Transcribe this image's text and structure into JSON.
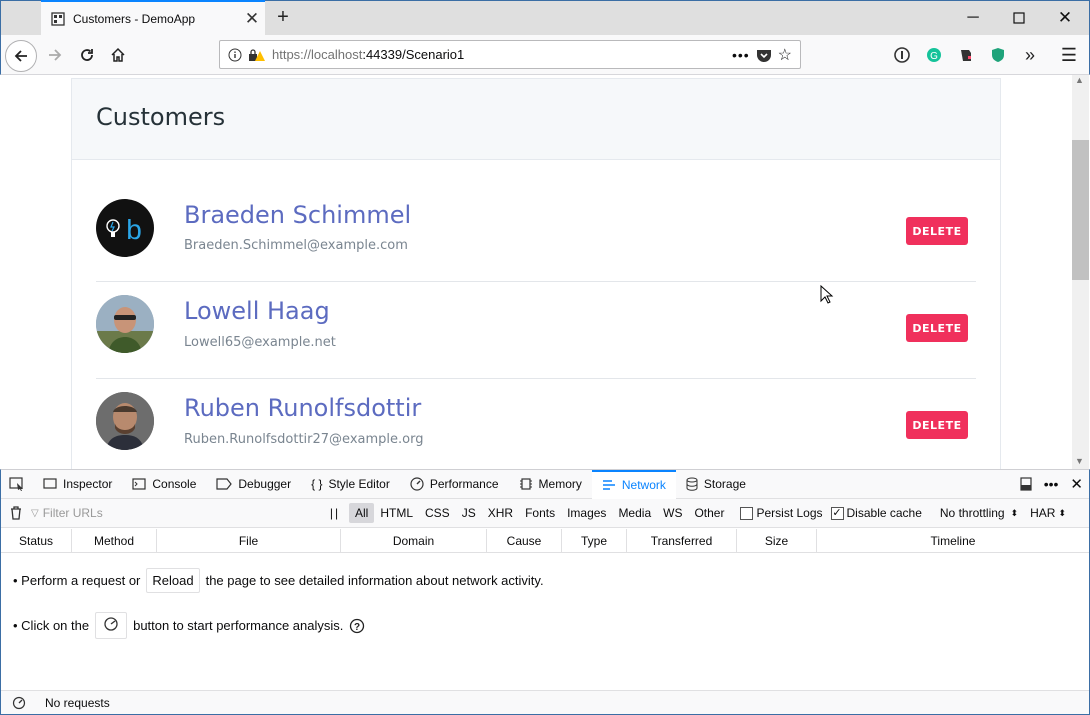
{
  "browser": {
    "tab_title": "Customers - DemoApp",
    "url_host": "https://localhost",
    "url_rest": ":44339/Scenario1"
  },
  "page": {
    "title": "Customers",
    "delete_label": "DELETE",
    "customers": [
      {
        "name": "Braeden Schimmel",
        "email": "Braeden.Schimmel@example.com"
      },
      {
        "name": "Lowell Haag",
        "email": "Lowell65@example.net"
      },
      {
        "name": "Ruben Runolfsdottir",
        "email": "Ruben.Runolfsdottir27@example.org"
      }
    ]
  },
  "devtools": {
    "tabs": [
      "Inspector",
      "Console",
      "Debugger",
      "Style Editor",
      "Performance",
      "Memory",
      "Network",
      "Storage"
    ],
    "selected_tab": "Network",
    "filter_placeholder": "Filter URLs",
    "filter_types": [
      "All",
      "HTML",
      "CSS",
      "JS",
      "XHR",
      "Fonts",
      "Images",
      "Media",
      "WS",
      "Other"
    ],
    "persist_logs": "Persist Logs",
    "disable_cache": "Disable cache",
    "throttling": "No throttling",
    "har": "HAR",
    "columns": [
      "Status",
      "Method",
      "File",
      "Domain",
      "Cause",
      "Type",
      "Transferred",
      "Size",
      "Timeline"
    ],
    "msg1_pre": "• Perform a request or",
    "reload_label": "Reload",
    "msg1_post": "the page to see detailed information about network activity.",
    "msg2_pre": "• Click on the",
    "msg2_post": "button to start performance analysis.",
    "status": "No requests"
  },
  "colors": {
    "accent": "#0a84ff",
    "delete": "#f0305c",
    "name": "#5c6bc0"
  }
}
